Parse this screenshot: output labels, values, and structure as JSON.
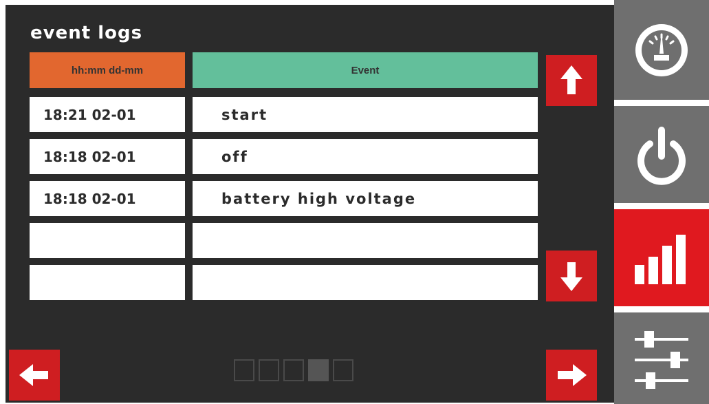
{
  "screen": {
    "title": "event logs"
  },
  "table": {
    "headers": {
      "time": "hh:mm dd-mm",
      "event": "Event"
    },
    "rows": [
      {
        "time": "18:21 02-01",
        "event": "start"
      },
      {
        "time": "18:18 02-01",
        "event": "off"
      },
      {
        "time": "18:18 02-01",
        "event": "battery high voltage"
      },
      {
        "time": "",
        "event": ""
      },
      {
        "time": "",
        "event": ""
      }
    ]
  },
  "pager": {
    "pages": 5,
    "current_page": 4
  },
  "sidebar": {
    "items": [
      {
        "icon": "gauge-icon",
        "active": false
      },
      {
        "icon": "power-icon",
        "active": false
      },
      {
        "icon": "bar-chart-icon",
        "active": true
      },
      {
        "icon": "sliders-icon",
        "active": false
      }
    ]
  },
  "colors": {
    "background": "#2b2b2b",
    "time_header": "#e2672f",
    "event_header": "#63bf9b",
    "accent_red": "#cf1e21",
    "sidebar_active": "#e0191f",
    "sidebar_inactive": "#6f6f6f"
  }
}
